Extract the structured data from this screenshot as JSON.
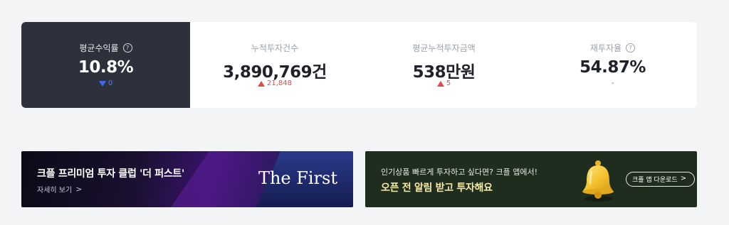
{
  "stats": [
    {
      "label": "평균수익률",
      "value": "10.8%",
      "change": "0",
      "direction": "down",
      "help": "?"
    },
    {
      "label": "누적투자건수",
      "value": "3,890,769건",
      "change": "21,848",
      "direction": "up"
    },
    {
      "label": "평균누적투자금액",
      "value": "538만원",
      "change": "5",
      "direction": "up"
    },
    {
      "label": "재투자율",
      "value": "54.87%",
      "change": "-",
      "direction": "none",
      "help": "?"
    }
  ],
  "banner_left": {
    "title": "크플 프리미엄 투자 클럽 '더 퍼스트'",
    "link_label": "자세히 보기",
    "link_chevron": ">",
    "logo_text": "The First"
  },
  "banner_right": {
    "subtitle": "인기상품 빠르게 투자하고 싶다면? 크플 앱에서!",
    "title": "오픈 전 알림 받고 투자해요",
    "button_label": "크플 앱 다운로드",
    "button_chevron": ">"
  },
  "colors": {
    "dark_panel": "#2d313c",
    "up": "#e24a4a",
    "down": "#3c6af0",
    "banner_right_bg": "#1f2d1e",
    "banner_right_accent": "#f7e9a6"
  }
}
